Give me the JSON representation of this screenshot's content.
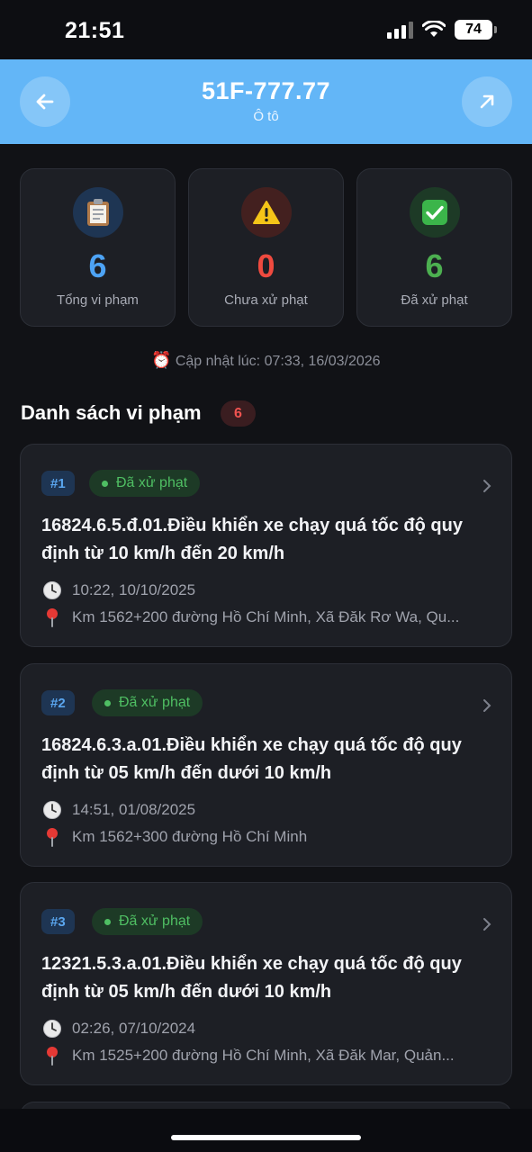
{
  "status_bar": {
    "time": "21:51",
    "battery": "74"
  },
  "header": {
    "plate": "51F-777.77",
    "vehicle_type": "Ô tô"
  },
  "stats": [
    {
      "icon": "clipboard-icon",
      "value": "6",
      "label": "Tổng vi phạm",
      "color": "#4da3f5",
      "bg": "#1e3553"
    },
    {
      "icon": "warning-icon",
      "value": "0",
      "label": "Chưa xử phạt",
      "color": "#ef4a3f",
      "bg": "#43201f"
    },
    {
      "icon": "check-icon",
      "value": "6",
      "label": "Đã xử phạt",
      "color": "#4caf50",
      "bg": "#1d3a26"
    }
  ],
  "updated": {
    "text": "Cập nhật lúc: 07:33, 16/03/2026"
  },
  "list": {
    "title": "Danh sách vi phạm",
    "count": "6"
  },
  "violations": [
    {
      "index": "#1",
      "status": "Đã xử phạt",
      "title": "16824.6.5.đ.01.Điều khiển xe chạy quá tốc độ quy định từ 10 km/h đến 20 km/h",
      "time": "10:22, 10/10/2025",
      "location": "Km 1562+200 đường Hồ Chí Minh, Xã Đăk Rơ Wa, Qu..."
    },
    {
      "index": "#2",
      "status": "Đã xử phạt",
      "title": "16824.6.3.a.01.Điều khiển xe chạy quá tốc độ quy định từ 05 km/h đến dưới 10 km/h",
      "time": "14:51, 01/08/2025",
      "location": "Km 1562+300 đường Hồ Chí Minh"
    },
    {
      "index": "#3",
      "status": "Đã xử phạt",
      "title": "12321.5.3.a.01.Điều khiển xe chạy quá tốc độ quy định từ 05 km/h đến dưới 10 km/h",
      "time": "02:26, 07/10/2024",
      "location": "Km 1525+200 đường Hồ Chí Minh, Xã Đăk Mar, Quản..."
    }
  ]
}
